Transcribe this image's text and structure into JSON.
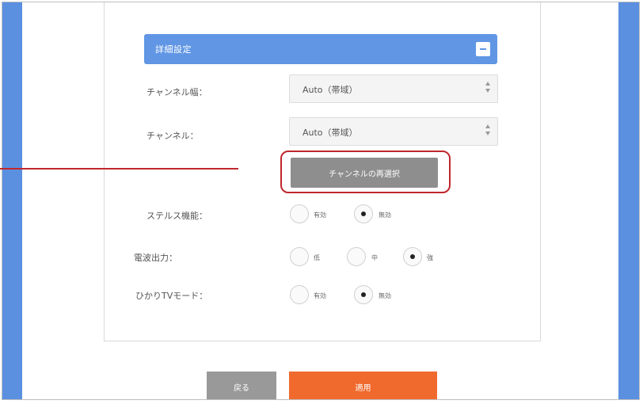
{
  "section": {
    "title": "詳細設定"
  },
  "rows": {
    "channel_width": {
      "label": "チャンネル幅：",
      "value": "Auto（帯域）"
    },
    "channel": {
      "label": "チャンネル：",
      "value": "Auto（帯域）"
    },
    "rescan_label": "チャンネルの再選択",
    "stealth": {
      "label": "ステルス機能：",
      "options": [
        "有効",
        "無効"
      ],
      "selected": "無効"
    },
    "power": {
      "label": "電波出力：",
      "options": [
        "低",
        "中",
        "強"
      ],
      "selected": "強"
    },
    "hikari_tv": {
      "label": "ひかりTVモード：",
      "options": [
        "有効",
        "無効"
      ],
      "selected": "無効"
    }
  },
  "footer": {
    "back_label": "戻る",
    "apply_label": "適用"
  },
  "colors": {
    "header": "#6096e4",
    "sidebar": "#5b8fe0",
    "highlight": "#c0272d",
    "apply": "#f06a2e",
    "back": "#999999",
    "rescan": "#8e8e8e"
  }
}
